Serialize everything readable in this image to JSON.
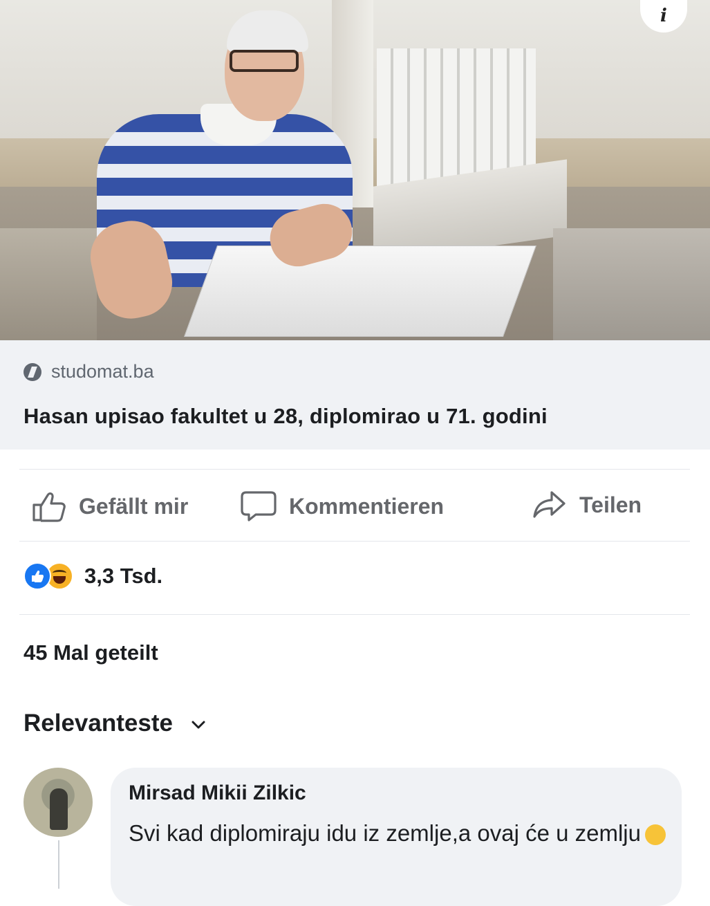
{
  "post": {
    "info_icon": "i",
    "link": {
      "source": "studomat.ba",
      "source_icon": "link-shield-icon",
      "headline": "Hasan upisao fakultet u 28, diplomirao u 71. godini"
    },
    "actions": {
      "like": "Gefällt mir",
      "comment": "Kommentieren",
      "share": "Teilen"
    },
    "reactions": {
      "icons": [
        "like-reaction-icon",
        "haha-reaction-icon"
      ],
      "count": "3,3 Tsd."
    },
    "shares": "45 Mal geteilt",
    "sort_label": "Relevanteste"
  },
  "comment": {
    "author": "Mirsad Mikii Zilkic",
    "text": "Svi kad diplomiraju idu iz zemlje,a ovaj će u zemlju",
    "emoji": "laughing-emoji"
  },
  "colors": {
    "background": "#ffffff",
    "preview_bg": "#f0f2f5",
    "action_gray": "#65676b",
    "like_blue": "#1877f2",
    "haha_yellow": "#f7b125"
  }
}
